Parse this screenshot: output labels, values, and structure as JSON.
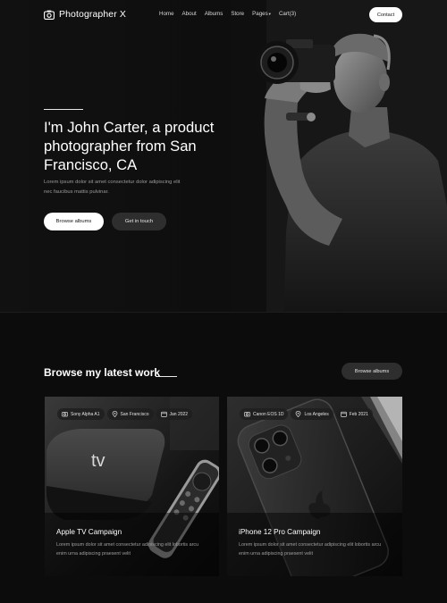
{
  "nav": {
    "brand": "Photographer X",
    "links": [
      "Home",
      "About",
      "Albums",
      "Store",
      "Pages",
      "Cart(3)"
    ],
    "pages_caret": "▾",
    "contact": "Contact"
  },
  "hero": {
    "title": "I'm John Carter, a product photographer from San Francisco, CA",
    "subtitle": "Lorem ipsum dolor sit amet consectetur dolor adipiscing elit nec faucibus mattis pulvinar.",
    "primary_button": "Browse albums",
    "secondary_button": "Get in touch"
  },
  "work": {
    "title": "Browse my latest work",
    "button": "Browse albums",
    "cards": [
      {
        "camera": "Sony Alpha A1",
        "location": "San Francisco",
        "date": "Jan 2022",
        "title": "Apple TV Campaign",
        "description": "Lorem ipsum dolor sit amet consectetur adipiscing elit lobortis arcu enim urna adipiscing praesent velit",
        "icons": [
          "camera-icon",
          "location-pin-icon",
          "calendar-icon"
        ]
      },
      {
        "camera": "Canon EOS 1D",
        "location": "Los Angeles",
        "date": "Feb 2021",
        "title": "iPhone 12 Pro Campaign",
        "description": "Lorem ipsum dolor sit amet consectetur adipiscing elit lobortis arcu enim urna adipiscing praesent velit",
        "icons": [
          "camera-icon",
          "location-pin-icon",
          "calendar-icon"
        ]
      }
    ]
  },
  "colors": {
    "background": "#0c0c0c",
    "card": "#1a1a1a",
    "pill_dark": "#2e2e2e",
    "accent_white": "#ffffff",
    "muted_text": "#9a9a9a"
  }
}
